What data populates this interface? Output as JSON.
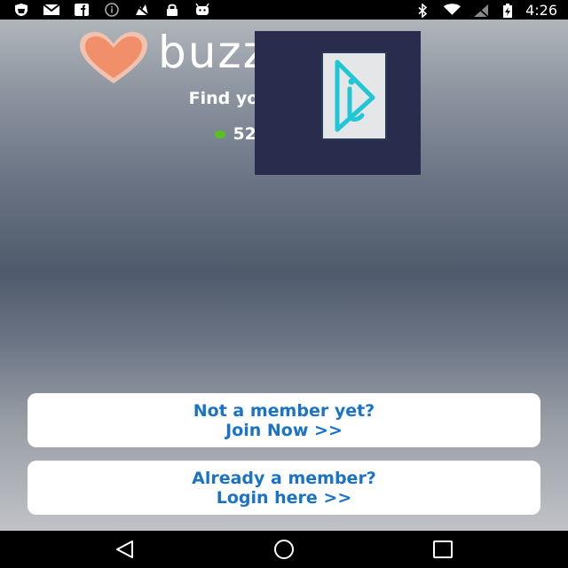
{
  "status_bar": {
    "time": "4:26",
    "left_icons": [
      "shield-icon",
      "mail-icon",
      "facebook-icon",
      "info-icon",
      "no-signal-icon",
      "lock-icon",
      "android-icon"
    ],
    "right_icons": [
      "bluetooth-icon",
      "wifi-icon",
      "no-sim-icon",
      "battery-charging-icon"
    ]
  },
  "header": {
    "brand": "buzz         im",
    "tagline": "Find your Asia                 mate",
    "online_text": "525 Mem                        ow"
  },
  "actions": {
    "join_line1": "Not a member yet?",
    "join_line2": "Join Now >>",
    "login_line1": "Already a member?",
    "login_line2": "Login here >>"
  },
  "colors": {
    "accent": "#1a73c8",
    "heart": "#f28f6b",
    "online_dot": "#58c21e",
    "overlay_bg": "#2a2c4e",
    "overlay_logo": "#1fc6d6"
  },
  "nav_bar": {
    "icons": [
      "back-icon",
      "home-icon",
      "recents-icon"
    ]
  }
}
